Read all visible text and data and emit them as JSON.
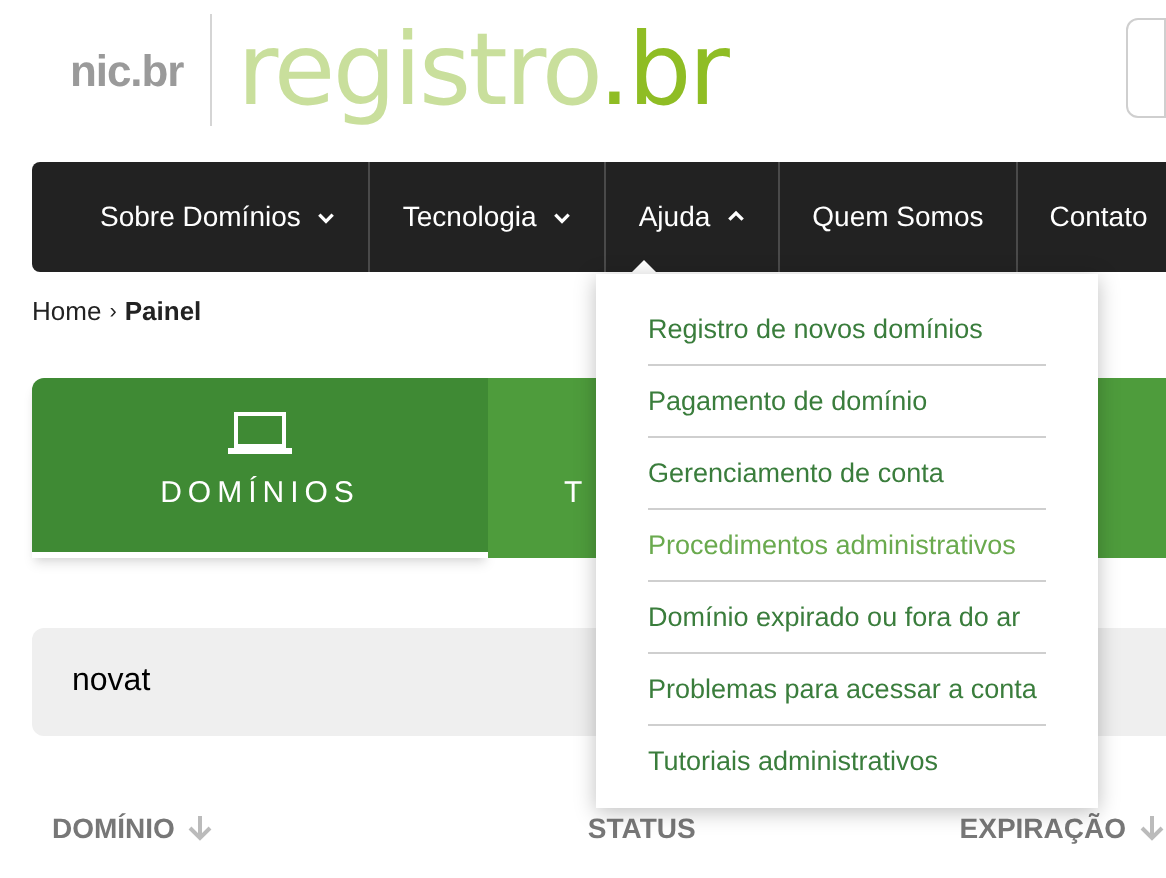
{
  "header": {
    "logo_small": "nic.br",
    "logo_main": "registro",
    "logo_suffix": ".br"
  },
  "nav": [
    {
      "label": "Sobre Domínios",
      "expanded": false
    },
    {
      "label": "Tecnologia",
      "expanded": false
    },
    {
      "label": "Ajuda",
      "expanded": true
    },
    {
      "label": "Quem Somos"
    },
    {
      "label": "Contato"
    }
  ],
  "breadcrumb": {
    "separator": "›",
    "items": [
      {
        "label": "Home",
        "current": false
      },
      {
        "label": "Painel",
        "current": true
      }
    ]
  },
  "tabs": [
    {
      "label": "DOMÍNIOS",
      "selected": true
    },
    {
      "label": "T",
      "selected": false
    }
  ],
  "search": {
    "value": "novat"
  },
  "table": {
    "columns": [
      {
        "label": "DOMÍNIO",
        "sorted": true
      },
      {
        "label": "STATUS",
        "sorted": false
      },
      {
        "label": "EXPIRAÇÃO",
        "sorted": true
      }
    ]
  },
  "dropdown": {
    "items": [
      {
        "label": "Registro de novos domínios",
        "selected": false
      },
      {
        "label": "Pagamento de domínio",
        "selected": false
      },
      {
        "label": "Gerenciamento de conta",
        "selected": false
      },
      {
        "label": "Procedimentos administrativos",
        "selected": true
      },
      {
        "label": "Domínio expirado ou fora do ar",
        "selected": false
      },
      {
        "label": "Problemas para acessar a conta",
        "selected": false
      },
      {
        "label": "Tutoriais administrativos",
        "selected": false
      }
    ]
  }
}
